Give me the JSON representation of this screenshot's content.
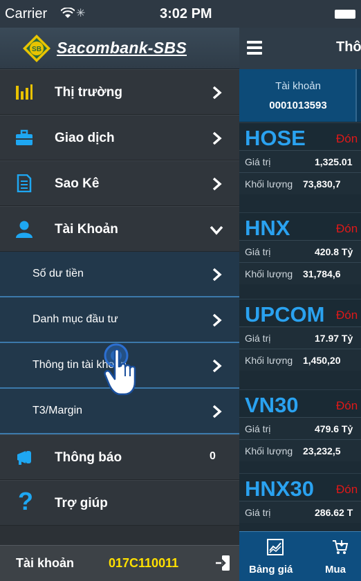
{
  "status_bar": {
    "carrier": "Carrier",
    "time": "3:02 PM"
  },
  "drawer": {
    "brand": "Sacombank-SBS",
    "menu": [
      {
        "label": "Thị trường",
        "icon": "bar-chart-icon"
      },
      {
        "label": "Giao dịch",
        "icon": "briefcase-icon"
      },
      {
        "label": "Sao Kê",
        "icon": "document-icon"
      },
      {
        "label": "Tài Khoản",
        "icon": "user-icon",
        "expanded": true
      }
    ],
    "submenu": [
      {
        "label": "Số dư tiền"
      },
      {
        "label": "Danh mục đầu tư"
      },
      {
        "label": "Thông tin tài khoản"
      },
      {
        "label": "T3/Margin"
      }
    ],
    "notifications": {
      "label": "Thông báo",
      "count": "0"
    },
    "help": {
      "label": "Trợ giúp"
    },
    "footer": {
      "label": "Tài khoản",
      "account": "017C110011"
    }
  },
  "main": {
    "title": "Thô",
    "account_tab": {
      "label": "Tài khoản",
      "value": "0001013593"
    },
    "markets": [
      {
        "name": "HOSE",
        "status": "Đón",
        "rows": [
          {
            "key": "Giá trị",
            "value": "1,325.01"
          },
          {
            "key": "Khối lượng",
            "value": "73,830,7"
          }
        ]
      },
      {
        "name": "HNX",
        "status": "Đón",
        "rows": [
          {
            "key": "Giá trị",
            "value": "420.8 Tỷ"
          },
          {
            "key": "Khối lượng",
            "value": "31,784,6"
          }
        ]
      },
      {
        "name": "UPCOM",
        "status": "Đón",
        "rows": [
          {
            "key": "Giá trị",
            "value": "17.97 Tỷ"
          },
          {
            "key": "Khối lượng",
            "value": "1,450,20"
          }
        ]
      },
      {
        "name": "VN30",
        "status": "Đón",
        "rows": [
          {
            "key": "Giá trị",
            "value": "479.6 Tỷ"
          },
          {
            "key": "Khối lượng",
            "value": "23,232,5"
          }
        ]
      },
      {
        "name": "HNX30",
        "status": "Đón",
        "rows": [
          {
            "key": "Giá trị",
            "value": "286.62 T"
          }
        ]
      }
    ],
    "tabbar": [
      {
        "label": "Bảng giá",
        "icon": "chart-line-icon"
      },
      {
        "label": "Mua",
        "icon": "cart-icon"
      }
    ]
  },
  "colors": {
    "accent": "#2aa2f0",
    "status_red": "#e01818",
    "account_yellow": "#ffe000",
    "brand_gold": "#e8c400"
  }
}
